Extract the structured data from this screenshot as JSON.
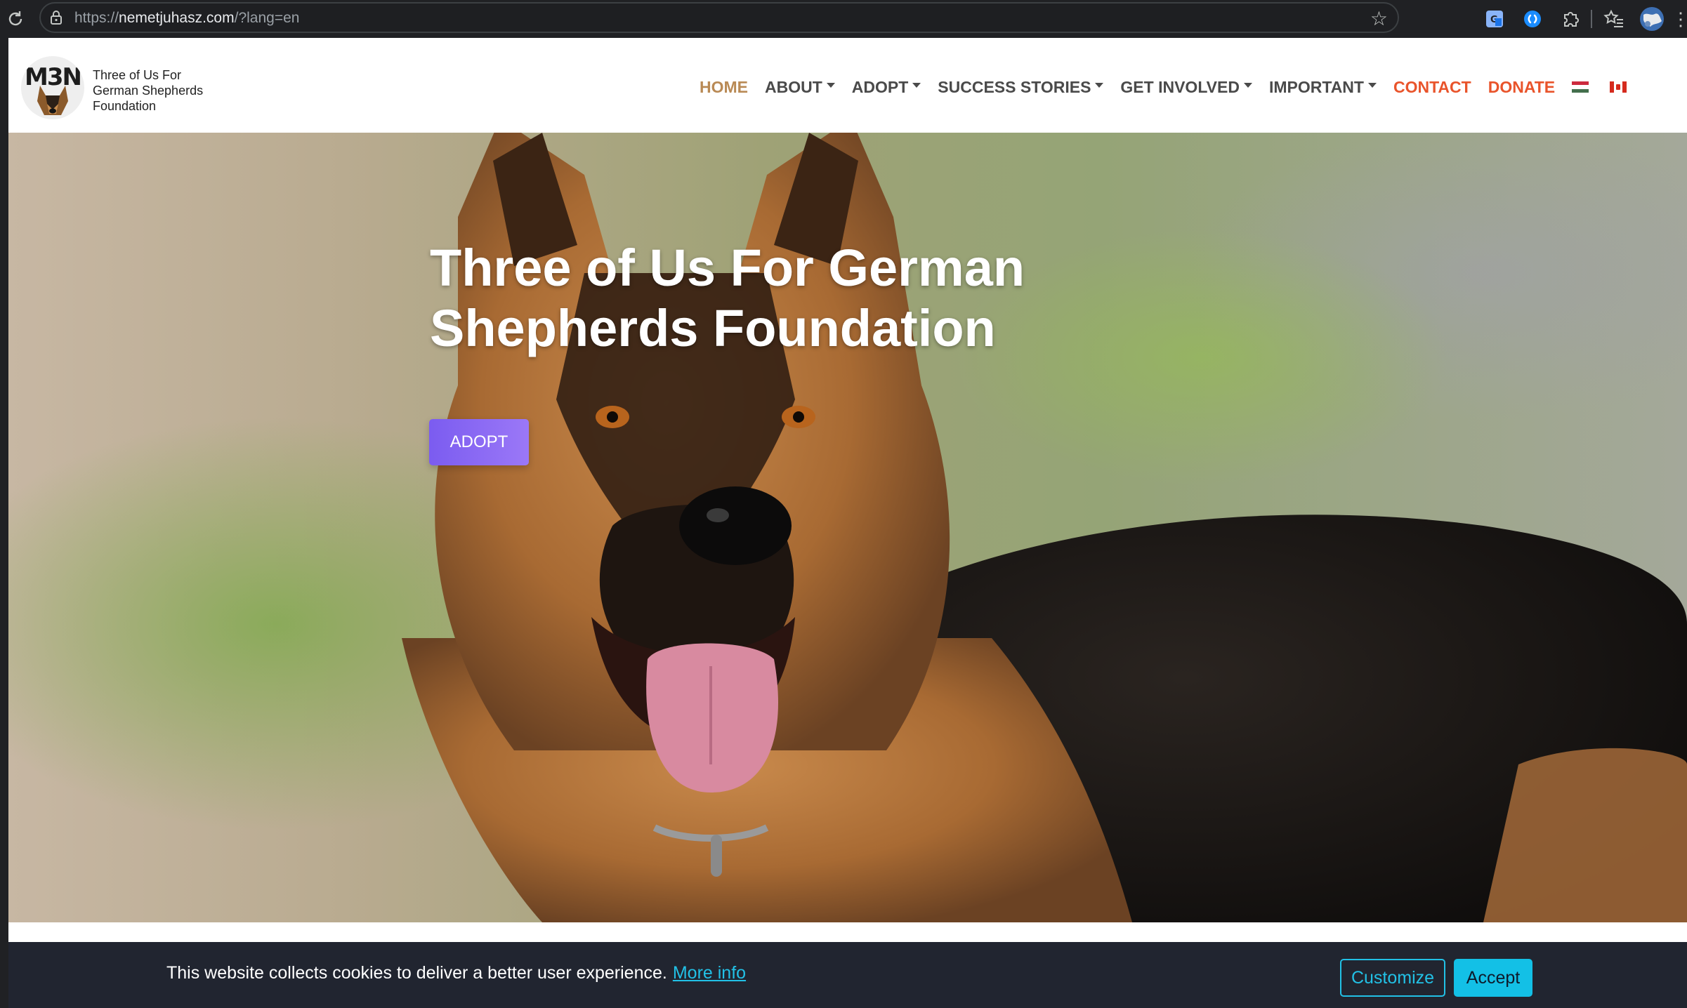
{
  "browser": {
    "url_prefix": "https://",
    "url_host": "nemetjuhasz.com",
    "url_path": "/?lang=en",
    "icons": [
      "reload-icon",
      "lock-icon",
      "bookmark-star-icon",
      "translate-icon",
      "shazam-icon",
      "extensions-puzzle-icon",
      "favorites-icon",
      "profile-avatar-icon",
      "more-menu-icon"
    ]
  },
  "site": {
    "logo_mark": "M3N",
    "logo_lines": [
      "Three of Us For",
      "German Shepherds",
      "Foundation"
    ],
    "nav": [
      {
        "label": "HOME",
        "dropdown": false
      },
      {
        "label": "ABOUT",
        "dropdown": true
      },
      {
        "label": "ADOPT",
        "dropdown": true
      },
      {
        "label": "SUCCESS STORIES",
        "dropdown": true
      },
      {
        "label": "GET INVOLVED",
        "dropdown": true
      },
      {
        "label": "IMPORTANT",
        "dropdown": true
      },
      {
        "label": "CONTACT",
        "dropdown": false
      },
      {
        "label": "DONATE",
        "dropdown": false
      }
    ],
    "languages": [
      "hungarian-flag-icon",
      "canadian-flag-icon"
    ],
    "colors": {
      "home": "#b98a55",
      "nav_text": "#4a4a4a",
      "highlight": "#e9542b",
      "adopt_button": "#8a68f4",
      "cookie_bg": "#212530",
      "cookie_accent": "#22c1e6"
    }
  },
  "hero": {
    "title_line1": "Three of Us For German",
    "title_line2": "Shepherds Foundation",
    "button_label": "ADOPT"
  },
  "cookie": {
    "text": "This website collects cookies to deliver a better user experience.",
    "link": "More info",
    "customize": "Customize",
    "accept": "Accept"
  }
}
